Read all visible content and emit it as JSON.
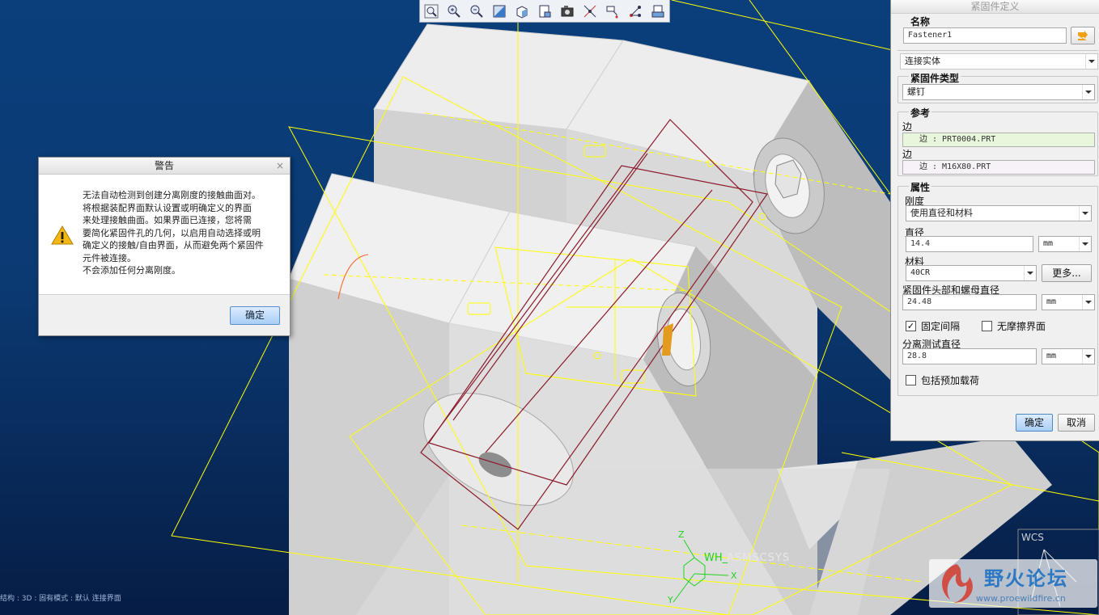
{
  "toolbar": {
    "buttons": [
      {
        "name": "zoom-refit-icon"
      },
      {
        "name": "zoom-in-icon"
      },
      {
        "name": "zoom-out-icon"
      },
      {
        "name": "repaint-icon"
      },
      {
        "name": "display-style-icon"
      },
      {
        "name": "saved-views-icon"
      },
      {
        "name": "view-manager-icon"
      },
      {
        "name": "datum-display-icon"
      },
      {
        "name": "annotation-display-icon"
      },
      {
        "name": "spin-center-icon"
      },
      {
        "name": "appearance-icon"
      }
    ]
  },
  "warning": {
    "title": "警告",
    "close": "×",
    "lines": [
      "无法自动检测到创建分离刚度的接触曲面对。",
      "将根据装配界面默认设置或明确定义的界面",
      "来处理接触曲面。如果界面已连接，您将需",
      "要简化紧固件孔的几何，以启用自动选择或明",
      "确定义的接触/自由界面，从而避免两个紧固件",
      "元件被连接。",
      "不会添加任何分离刚度。"
    ],
    "ok_label": "确定"
  },
  "panel": {
    "title": "紧固件定义",
    "name_label": "名称",
    "name_value": "Fastener1",
    "connection_select": "连接实体",
    "fastener_type_label": "紧固件类型",
    "fastener_type_value": "螺钉",
    "references_label": "参考",
    "ref1_label": "边",
    "ref1_value": "边 : PRT0004.PRT",
    "ref2_label": "边",
    "ref2_value": "边 : M16X80.PRT",
    "properties_label": "属性",
    "stiffness_label": "刚度",
    "stiffness_value": "使用直径和材料",
    "diameter_label": "直径",
    "diameter_value": "14.4",
    "diameter_unit": "mm",
    "material_label": "材料",
    "material_value": "40CR",
    "more_button": "更多...",
    "head_nut_label": "紧固件头部和螺母直径",
    "head_nut_value": "24.48",
    "head_nut_unit": "mm",
    "fixed_gap_label": "固定间隔",
    "fixed_gap_checked": true,
    "frictionless_label": "无摩擦界面",
    "frictionless_checked": false,
    "sep_test_label": "分离测试直径",
    "sep_test_value": "28.8",
    "sep_test_unit": "mm",
    "preload_label": "包括预加载荷",
    "preload_checked": false,
    "ok_label": "确定",
    "cancel_label": "取消"
  },
  "viewport": {
    "csys_label": "ASMSCSYS",
    "csys_prefix": "WH_",
    "axis_z": "Z",
    "axis_x": "X",
    "axis_y": "Y",
    "wcs_label": "WCS"
  },
  "statusbar": {
    "text": "结构 : 3D : 固有模式 : 默认 连接界面"
  },
  "watermark": {
    "title": "野火论坛",
    "url": "www.proewildfire.cn"
  },
  "colors": {
    "background_top": "#0a3f7c",
    "background_bottom": "#061d45",
    "datum_yellow": "#ffff00",
    "fastener_red": "#8b1a2b",
    "accent_blue": "#4f86c6"
  }
}
